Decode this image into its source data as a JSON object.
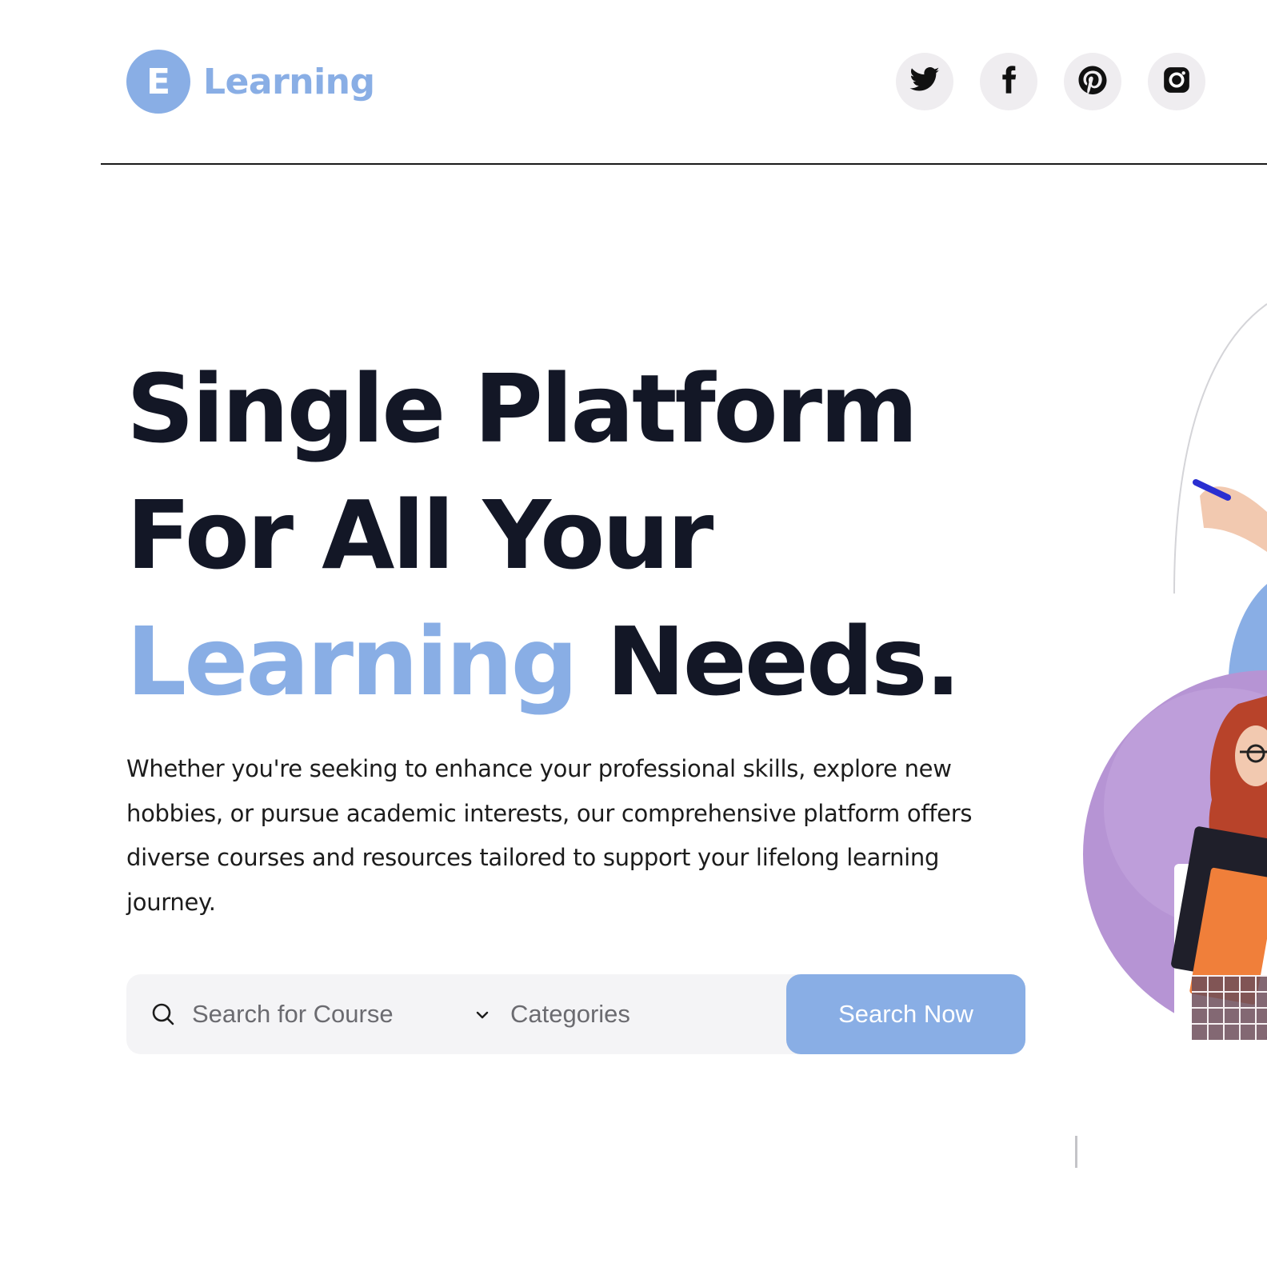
{
  "brand": {
    "badge_letter": "E",
    "name": "Learning",
    "accent_color": "#89aee5"
  },
  "socials": [
    {
      "name": "twitter-icon"
    },
    {
      "name": "facebook-icon"
    },
    {
      "name": "pinterest-icon"
    },
    {
      "name": "instagram-icon"
    }
  ],
  "hero": {
    "title_line1": "Single Platform",
    "title_line2": "For All Your",
    "title_accent": "Learning",
    "title_end": " Needs.",
    "description": "Whether you're seeking to enhance your professional skills, explore new hobbies, or pursue academic interests, our comprehensive platform offers diverse courses and resources tailored to support your lifelong learning journey."
  },
  "search": {
    "placeholder": "Search for Course",
    "category_label": "Categories",
    "button_label": "Search Now"
  }
}
